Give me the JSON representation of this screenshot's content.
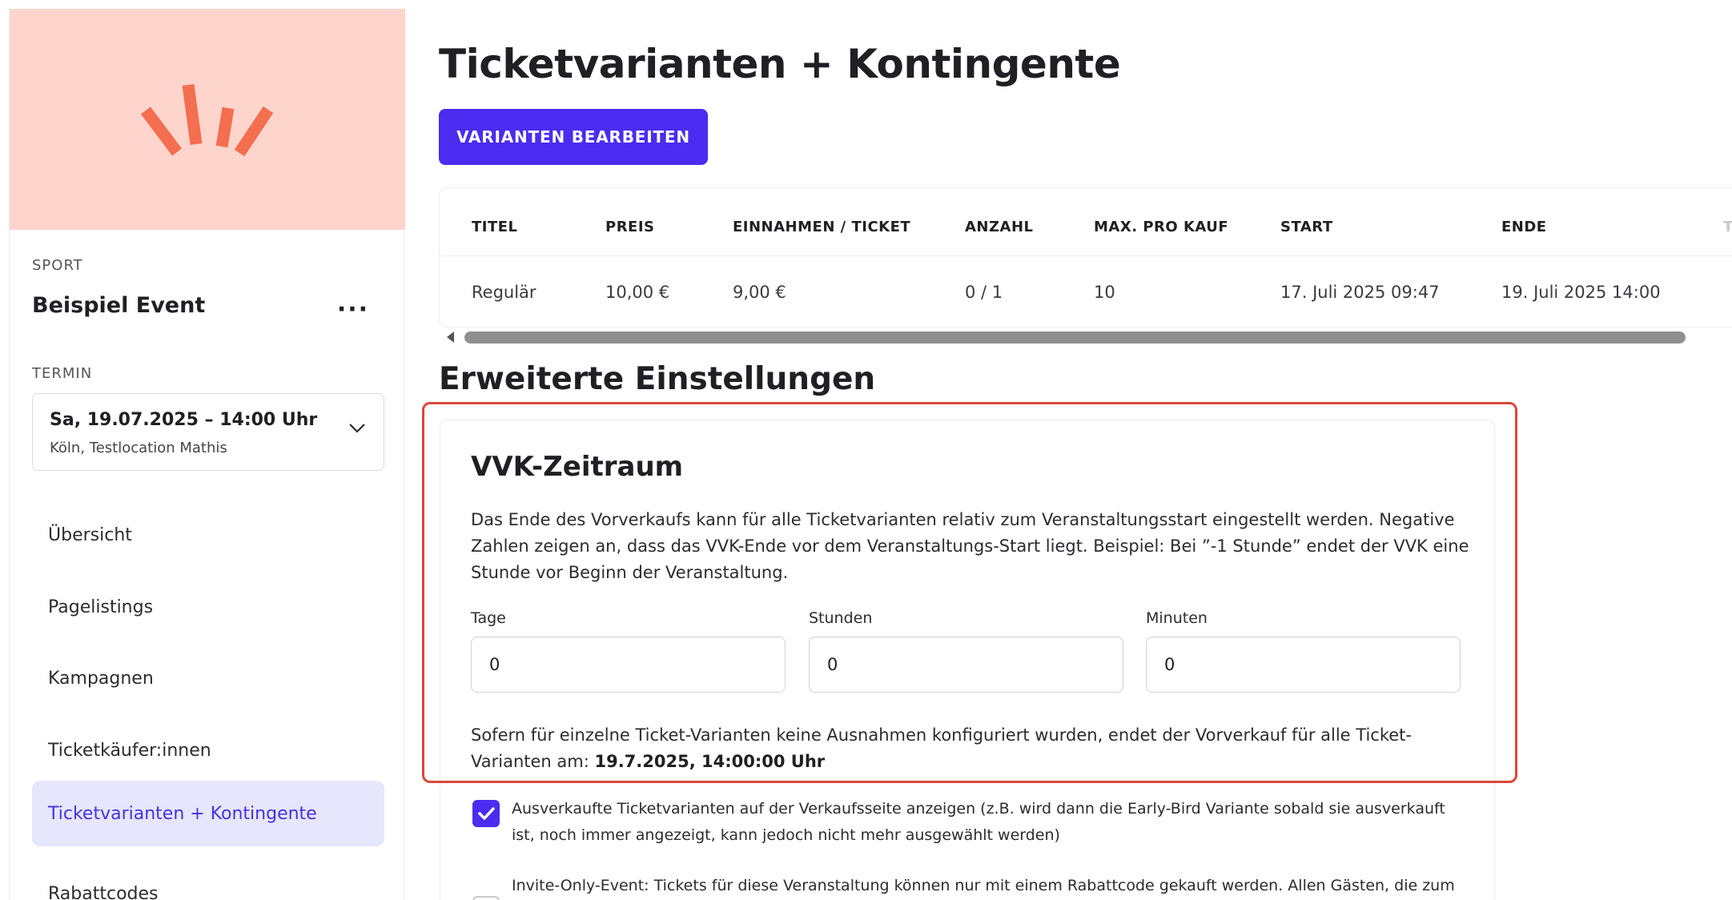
{
  "sidebar": {
    "category": "SPORT",
    "event_name": "Beispiel Event",
    "more_label": "···",
    "termin_label": "TERMIN",
    "date_select": {
      "date": "Sa, 19.07.2025 – 14:00 Uhr",
      "location": "Köln, Testlocation Mathis"
    },
    "nav": [
      {
        "label": "Übersicht"
      },
      {
        "label": "Pagelistings"
      },
      {
        "label": "Kampagnen"
      },
      {
        "label": "Ticketkäufer:innen"
      },
      {
        "label": "Ticketvarianten + Kontingente",
        "active": true
      },
      {
        "label": "Rabattcodes"
      }
    ]
  },
  "main": {
    "title": "Ticketvarianten + Kontingente",
    "edit_button": "VARIANTEN BEARBEITEN",
    "table": {
      "headers": [
        "TITEL",
        "PREIS",
        "EINNAHMEN / TICKET",
        "ANZAHL",
        "MAX. PRO KAUF",
        "START",
        "ENDE",
        "T"
      ],
      "rows": [
        [
          "Regulär",
          "10,00 €",
          "9,00 €",
          "0 / 1",
          "10",
          "17. Juli 2025 09:47",
          "19. Juli 2025 14:00"
        ]
      ]
    },
    "advanced_title": "Erweiterte Einstellungen",
    "vvk": {
      "title": "VVK-Zeitraum",
      "description": "Das Ende des Vorverkaufs kann für alle Ticketvarianten relativ zum Veranstaltungsstart eingestellt werden. Negative Zahlen zeigen an, dass das VVK-Ende vor dem Veranstaltungs-Start liegt. Beispiel: Bei ”-1 Stunde” endet der VVK eine Stunde vor Beginn der Veranstaltung.",
      "fields": [
        {
          "label": "Tage",
          "value": "0"
        },
        {
          "label": "Stunden",
          "value": "0"
        },
        {
          "label": "Minuten",
          "value": "0"
        }
      ],
      "hint_prefix": "Sofern für einzelne Ticket-Varianten keine Ausnahmen konfiguriert wurden, endet der Vorverkauf für alle Ticket-Varianten am: ",
      "hint_date": "19.7.2025, 14:00:00 Uhr"
    },
    "options": [
      {
        "checked": true,
        "text": "Ausverkaufte Ticketvarianten auf der Verkaufsseite anzeigen (z.B. wird dann die Early-Bird Variante sobald sie ausverkauft ist, noch immer angezeigt, kann jedoch nicht mehr ausgewählt werden)"
      },
      {
        "checked": false,
        "text": "Invite-Only-Event: Tickets für diese Veranstaltung können nur mit einem Rabattcode gekauft werden. Allen Gästen, die zum"
      }
    ]
  },
  "colors": {
    "accent": "#4b2cf0",
    "hero_bg": "#fdd5cc",
    "logo": "#f46e50",
    "highlight": "#d9473b",
    "active_nav_bg": "#e6e6fd"
  }
}
